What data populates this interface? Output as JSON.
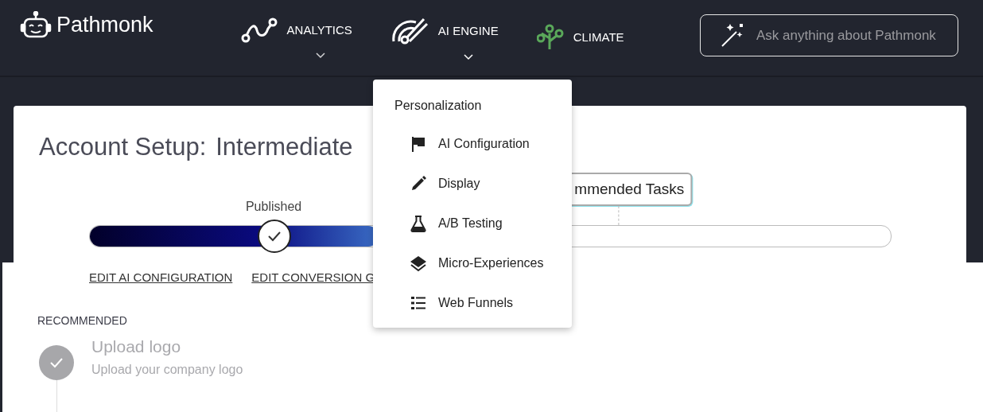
{
  "brand": {
    "name": "Pathmonk"
  },
  "nav": [
    {
      "label": "ANALYTICS",
      "kind": "analytics",
      "has_menu": true,
      "open": false
    },
    {
      "label": "AI ENGINE",
      "kind": "engine",
      "has_menu": true,
      "open": true
    },
    {
      "label": "CLIMATE",
      "kind": "climate",
      "has_menu": false,
      "open": false
    }
  ],
  "ask": {
    "placeholder": "Ask anything about Pathmonk"
  },
  "menu": {
    "heading": "Personalization",
    "items": [
      {
        "label": "AI Configuration",
        "kind": "flag"
      },
      {
        "label": "Display",
        "kind": "pencil"
      },
      {
        "label": "A/B Testing",
        "kind": "flask"
      },
      {
        "label": "Micro-Experiences",
        "kind": "layers"
      },
      {
        "label": "Web Funnels",
        "kind": "list"
      }
    ]
  },
  "setup": {
    "title_label": "Account Setup:",
    "title_value": "Intermediate",
    "progress": {
      "level": 0.36,
      "milestone": {
        "label": "Published",
        "level": 0.23,
        "done": true
      },
      "callout": {
        "text": "mmended Tasks",
        "level": 0.66
      }
    },
    "links": [
      "EDIT AI CONFIGURATION",
      "EDIT CONVERSION G"
    ],
    "section": "RECOMMENDED",
    "tasks": [
      {
        "title": "Upload logo",
        "subtitle": "Upload your company logo",
        "done": true
      }
    ]
  }
}
